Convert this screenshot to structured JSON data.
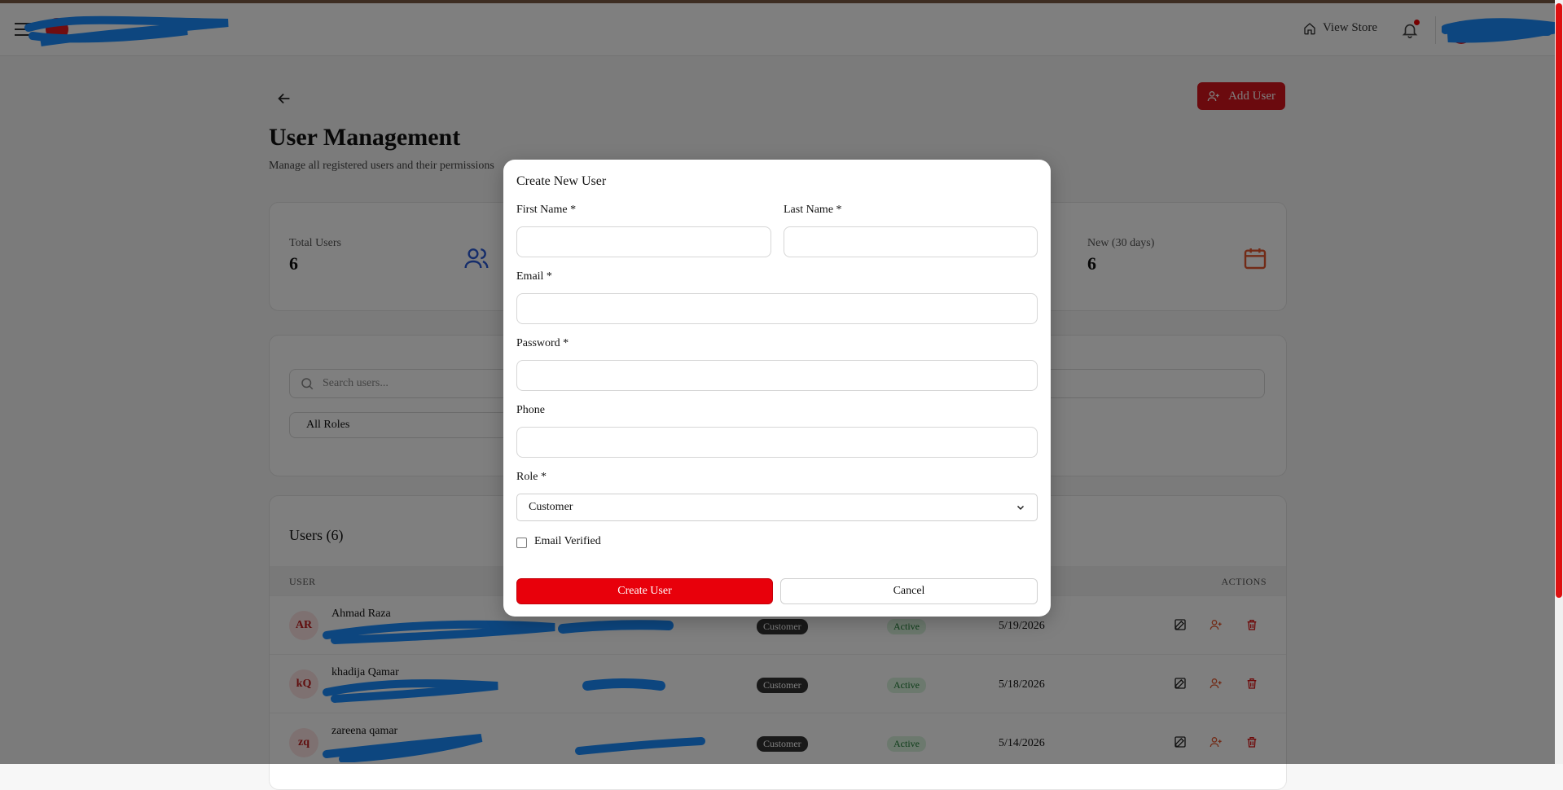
{
  "header": {
    "view_store": "View Store"
  },
  "page": {
    "add_user_label": "Add User",
    "title": "User Management",
    "subtitle": "Manage all registered users and their permissions"
  },
  "stats": [
    {
      "label": "Total Users",
      "value": "6",
      "icon": "users-icon",
      "color": "#2b5bd7"
    },
    {
      "label": "New (30 days)",
      "value": "6",
      "icon": "calendar-icon",
      "color": "#e4572e"
    }
  ],
  "filters": {
    "search_placeholder": "Search users...",
    "role_value": "All Roles"
  },
  "users": {
    "title": "Users (6)",
    "col_user": "USER",
    "col_actions": "ACTIONS",
    "rows": [
      {
        "initials": "AR",
        "name": "Ahmad Raza",
        "role": "Customer",
        "status": "Active",
        "date": "5/19/2026"
      },
      {
        "initials": "kQ",
        "name": "khadija Qamar",
        "role": "Customer",
        "status": "Active",
        "date": "5/18/2026"
      },
      {
        "initials": "zq",
        "name": "zareena qamar",
        "role": "Customer",
        "status": "Active",
        "date": "5/14/2026"
      }
    ]
  },
  "modal": {
    "title": "Create New User",
    "first_name_label": "First Name *",
    "last_name_label": "Last Name *",
    "email_label": "Email *",
    "password_label": "Password *",
    "phone_label": "Phone",
    "role_label": "Role *",
    "role_value": "Customer",
    "email_verified_label": "Email Verified",
    "create_label": "Create User",
    "cancel_label": "Cancel"
  },
  "colors": {
    "brand": "#d7151d",
    "primary_button": "#e8000b"
  }
}
